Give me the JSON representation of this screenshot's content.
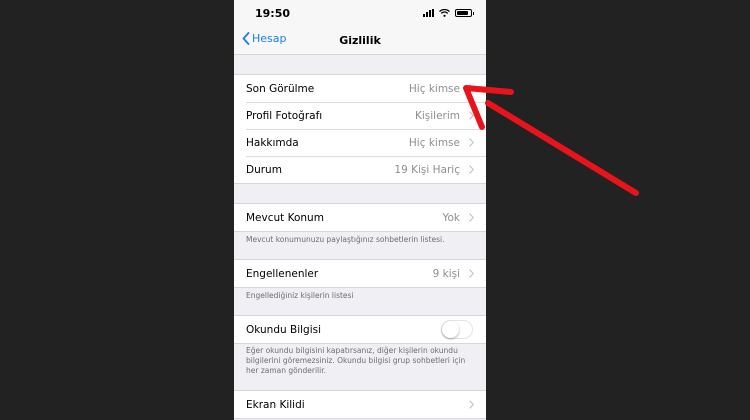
{
  "status_bar": {
    "time": "19:50"
  },
  "nav": {
    "back_label": "Hesap",
    "title": "Gizlilik"
  },
  "privacy_rows": [
    {
      "label": "Son Görülme",
      "value": "Hiç kimse"
    },
    {
      "label": "Profil Fotoğrafı",
      "value": "Kişilerim"
    },
    {
      "label": "Hakkımda",
      "value": "Hiç kimse"
    },
    {
      "label": "Durum",
      "value": "19 Kişi Hariç"
    }
  ],
  "live_location": {
    "label": "Mevcut Konum",
    "value": "Yok",
    "footnote": "Mevcut konumunuzu paylaştığınız sohbetlerin listesi."
  },
  "blocked": {
    "label": "Engellenenler",
    "value": "9 kişi",
    "footnote": "Engellediğiniz kişilerin listesi"
  },
  "read_receipts": {
    "label": "Okundu Bilgisi",
    "enabled": false,
    "footnote": "Eğer okundu bilgisini kapatırsanız, diğer kişilerin okundu bilgilerini göremezsiniz. Okundu bilgisi grup sohbetleri için her zaman gönderilir."
  },
  "screen_lock": {
    "label": "Ekran Kilidi"
  },
  "colors": {
    "accent": "#1a7cf5",
    "annotation": "#e8141c",
    "background": "#222222"
  }
}
